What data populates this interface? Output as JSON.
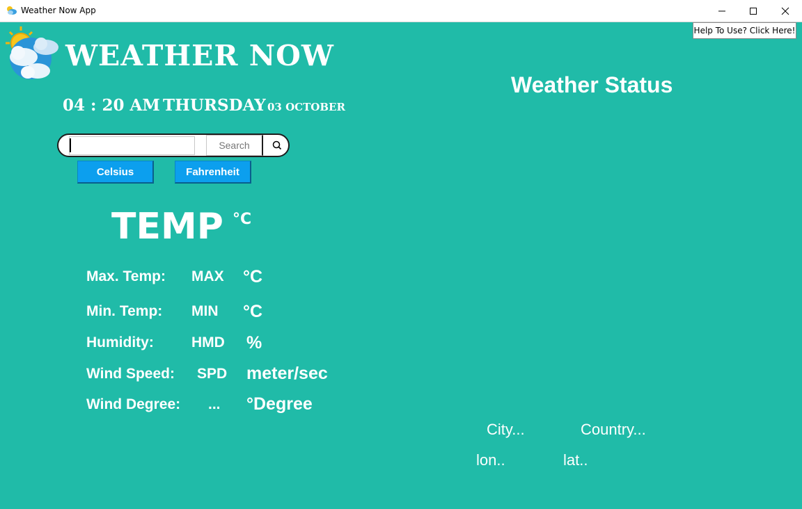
{
  "window": {
    "title": "Weather Now App"
  },
  "header": {
    "brand": "WEATHER NOW",
    "help_button": "Help To Use? Click Here!",
    "status_title": "Weather Status"
  },
  "datetime": {
    "time": "04 : 20 AM",
    "day": "THURSDAY",
    "date": "03 OCTOBER"
  },
  "search": {
    "value": "",
    "button_label": "Search"
  },
  "units": {
    "celsius_label": "Celsius",
    "fahrenheit_label": "Fahrenheit"
  },
  "temperature": {
    "value": "TEMP",
    "unit": "°C"
  },
  "stats": {
    "max": {
      "label": "Max. Temp:",
      "value": "MAX",
      "unit": "°C"
    },
    "min": {
      "label": "Min. Temp:",
      "value": "MIN",
      "unit": "°C"
    },
    "humidity": {
      "label": "Humidity:",
      "value": "HMD",
      "unit": "%"
    },
    "wind_speed": {
      "label": "Wind Speed:",
      "value": "SPD",
      "unit": "meter/sec"
    },
    "wind_degree": {
      "label": "Wind Degree:",
      "value": "...",
      "unit": "°Degree"
    }
  },
  "location": {
    "city": "City...",
    "country": "Country...",
    "lon": "lon..",
    "lat": "lat.."
  },
  "colors": {
    "background": "#20bba8",
    "button_blue": "#0c9fee"
  },
  "icons": {
    "app": "weather-sun-cloud-icon",
    "logo": "weather-sun-cloud-logo",
    "search": "search-icon"
  }
}
